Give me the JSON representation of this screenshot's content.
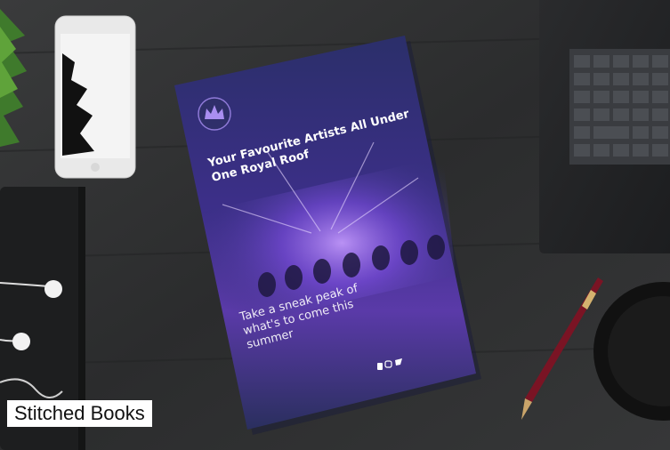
{
  "caption": "Stitched Books",
  "booklet": {
    "headline": "Your Favourite Artists All Under One Royal Roof",
    "tagline": "Take a sneak peak of what's to come this summer"
  },
  "colors": {
    "desk": "#2e2f30",
    "booklet_cover": "#2a2f6e",
    "accent_purple": "#7a4cd9",
    "pen": "#7a1424"
  },
  "icons": [
    "crown-logo-icon",
    "facebook-icon",
    "instagram-icon",
    "twitter-icon"
  ]
}
